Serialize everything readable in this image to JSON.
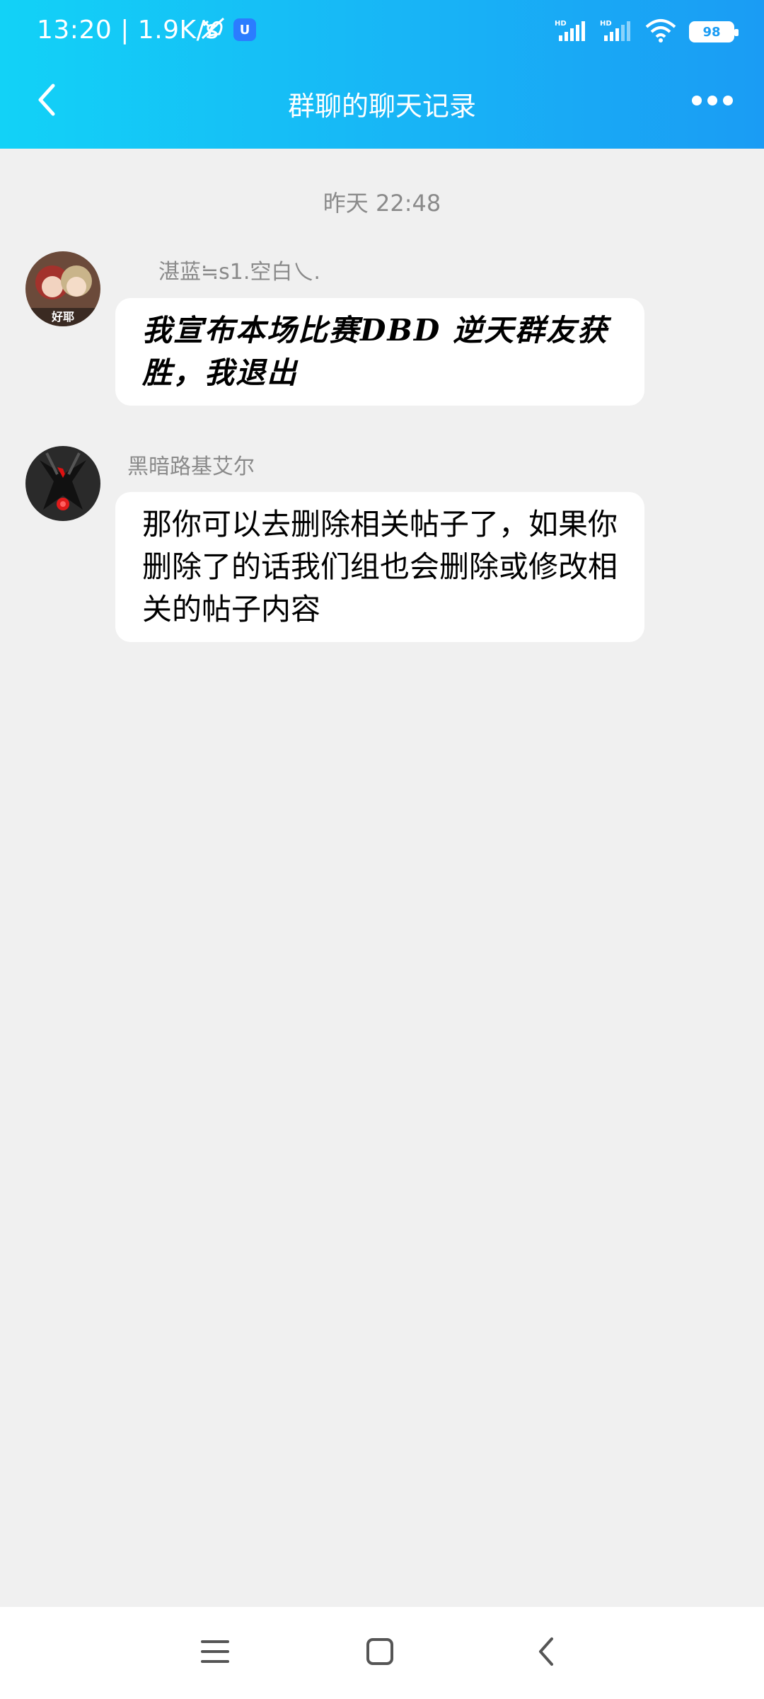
{
  "status_bar": {
    "time": "13:20",
    "separator": "|",
    "network_speed": "1.9K/s",
    "battery_level": "98",
    "icons": [
      "vibrate-off-icon",
      "app-badge-icon",
      "signal-hd-icon",
      "signal-hd-icon",
      "wifi-icon",
      "battery-icon"
    ]
  },
  "header": {
    "title": "群聊的聊天记录",
    "back_icon": "chevron-left-icon",
    "more_icon": "more-dots-icon"
  },
  "chat": {
    "time_divider": "昨天 22:48",
    "messages": [
      {
        "sender": "湛蓝≒s1.空白乀.",
        "avatar_label": "好耶",
        "text": "我宣布本场比赛DBD 逆天群友获胜，我退出"
      },
      {
        "sender": "黑暗路基艾尔",
        "text": "那你可以去删除相关帖子了，如果你删除了的话我们组也会删除或修改相关的帖子内容"
      }
    ]
  },
  "nav_bar": {
    "items": [
      "menu-icon",
      "home-icon",
      "back-icon"
    ]
  },
  "colors": {
    "header_gradient_start": "#12d2f7",
    "header_gradient_end": "#1a9cf4",
    "background": "#f0f0f0",
    "bubble": "#ffffff",
    "meta_text": "#8a8a8a"
  }
}
